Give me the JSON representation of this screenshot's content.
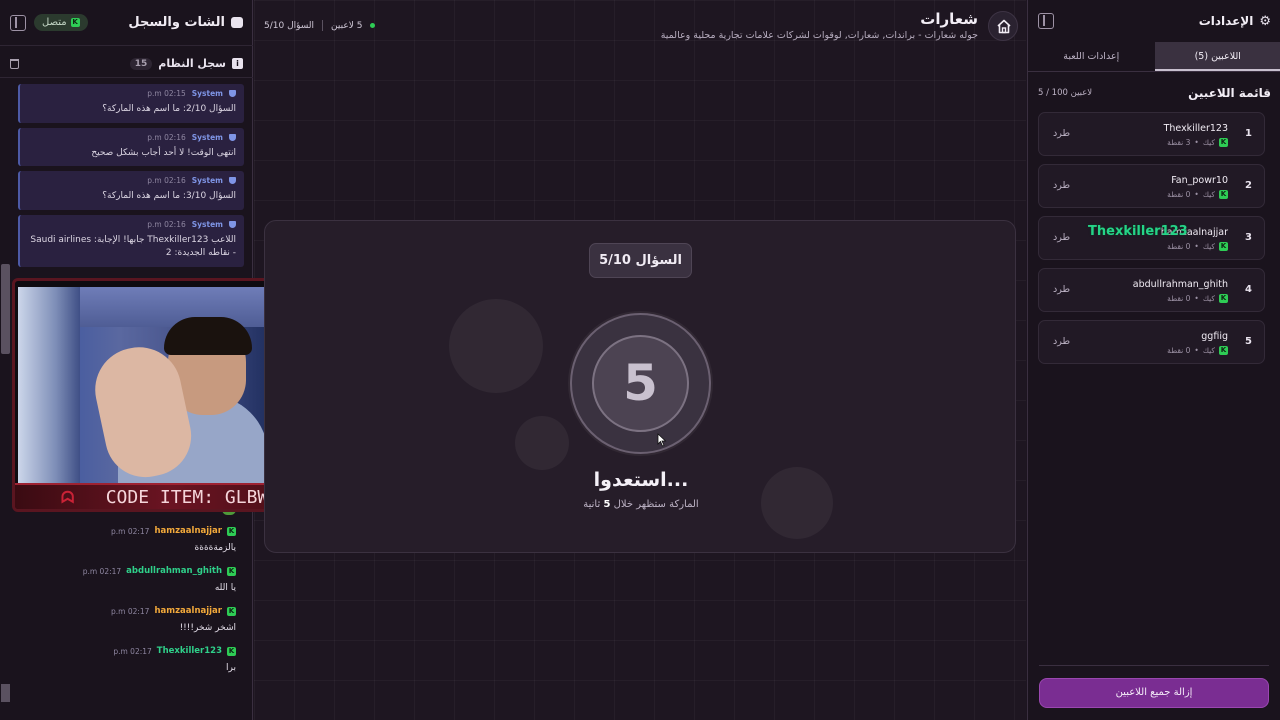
{
  "chat": {
    "title": "الشات والسجل",
    "status": "متصل",
    "syslog_title": "سجل النظام",
    "syslog_count": "15",
    "system_messages": [
      {
        "sender": "System",
        "time": "02:15 p.m",
        "text": "السؤال 2/10: ما اسم هذه الماركة؟"
      },
      {
        "sender": "System",
        "time": "02:16 p.m",
        "text": "انتهى الوقت! لا أحد أجاب بشكل صحيح"
      },
      {
        "sender": "System",
        "time": "02:16 p.m",
        "text": "السؤال 3/10: ما اسم هذه الماركة؟"
      },
      {
        "sender": "System",
        "time": "02:16 p.m",
        "text": "اللاعب Thexkiller123 جابها! الإجابة: Saudi airlines - نقاطه الجديدة: 2"
      }
    ],
    "messages": [
      {
        "user": "hamzaalnajjar",
        "time": "02:17 p.m",
        "text": "يالزمةةةةة",
        "color": "#f2a93b"
      },
      {
        "user": "abdullrahman_ghith",
        "time": "02:17 p.m",
        "text": "يا الله",
        "color": "#2fd08a"
      },
      {
        "user": "hamzaalnajjar",
        "time": "02:17 p.m",
        "text": "اشخر شخر!!!!",
        "color": "#f2a93b"
      },
      {
        "user": "Thexkiller123",
        "time": "02:17 p.m",
        "text": "برا",
        "color": "#2fd08a"
      }
    ]
  },
  "webcam": {
    "banner": "CODE ITEM: GLBW"
  },
  "header": {
    "title": "شعارات",
    "subtitle": "جوله شعارات - براندات, شعارات, لوقوات لشركات علامات تجارية محلية وعالمية",
    "players_online": "5 لاعبين",
    "question_progress": "السؤال 5/10"
  },
  "game": {
    "question_label": "السؤال 5/10",
    "countdown": "5",
    "ready_title": "استعدوا...",
    "ready_sub_before": "الماركة ستظهر خلال",
    "ready_sub_seconds": "5",
    "ready_sub_after": "ثانية"
  },
  "settings": {
    "title": "الإعدادات",
    "tabs": [
      {
        "label": "اللاعبين (5)",
        "active": true
      },
      {
        "label": "إعدادات اللعبة",
        "active": false
      }
    ],
    "players_title": "قائمة اللاعبين",
    "players_count": "5 / 100 لاعبين",
    "kick_label": "طرد",
    "platform": "كيك",
    "players": [
      {
        "rank": "1",
        "name": "Thexkiller123",
        "points": "3 نقطة"
      },
      {
        "rank": "2",
        "name": "Fan_powr10",
        "points": "0 نقطة"
      },
      {
        "rank": "3",
        "name": "hamzaalnajjar",
        "points": "0 نقطة"
      },
      {
        "rank": "4",
        "name": "abdullrahman_ghith",
        "points": "0 نقطة"
      },
      {
        "rank": "5",
        "name": "ggfiig",
        "points": "0 نقطة"
      }
    ],
    "floating_name": "Thexkiller123",
    "remove_all_label": "إزالة جميع اللاعبين"
  }
}
